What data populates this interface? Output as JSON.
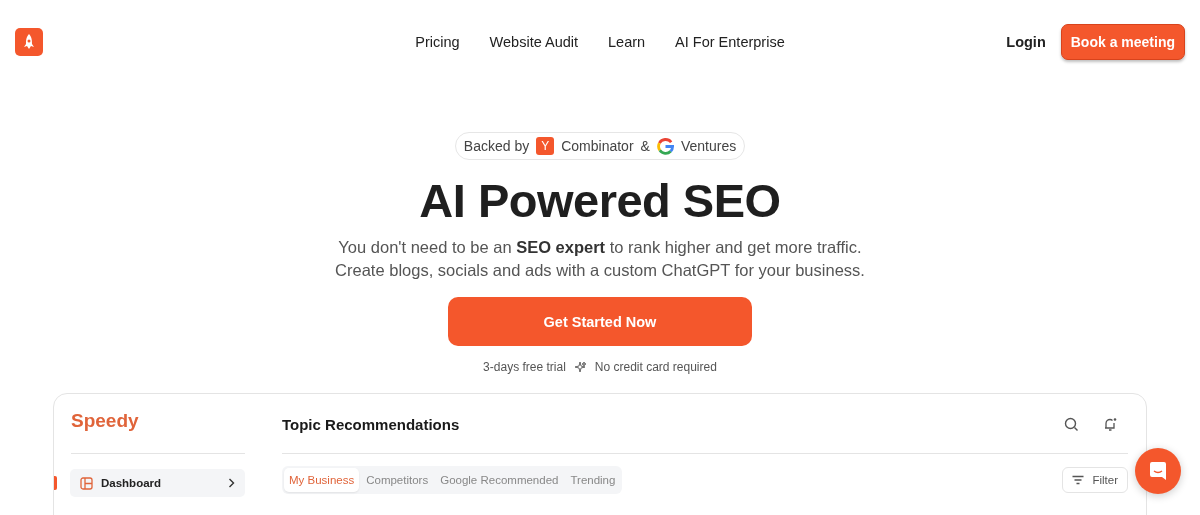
{
  "nav": {
    "links": [
      "Pricing",
      "Website Audit",
      "Learn",
      "AI For Enterprise"
    ],
    "login": "Login",
    "cta": "Book a meeting"
  },
  "hero": {
    "backed": {
      "prefix": "Backed by",
      "first": "Combinator",
      "first_mark": "Y",
      "joiner": "&",
      "second": "Ventures"
    },
    "title": "AI Powered SEO",
    "subtitle": [
      "You don't need to be an **SEO expert** to rank higher and get more traffic.",
      "Create blogs, socials and ads with a custom ChatGPT for your business."
    ],
    "cta": "Get Started Now",
    "notes": [
      "3-days free trial",
      "No credit card required"
    ]
  },
  "app": {
    "logo": "Speedy",
    "sidebar": {
      "items": [
        {
          "label": "Dashboard",
          "selected": true
        }
      ]
    },
    "title": "Topic Recommendations",
    "tabs": [
      {
        "label": "My Business",
        "selected": true
      },
      {
        "label": "Competitors",
        "selected": false
      },
      {
        "label": "Google Recommended",
        "selected": false
      },
      {
        "label": "Trending",
        "selected": false
      }
    ],
    "filter": "Filter"
  }
}
